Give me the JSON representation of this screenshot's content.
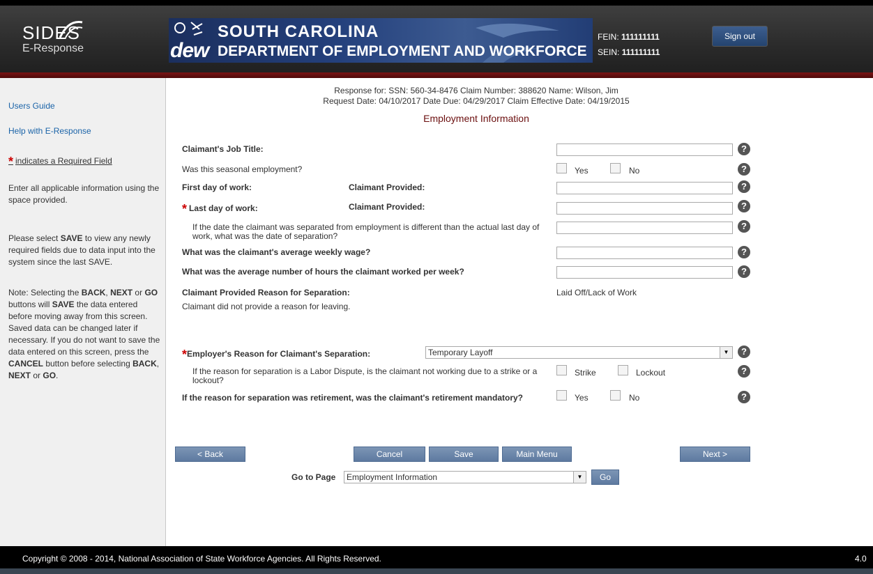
{
  "header": {
    "sides_logo_line1": "SIDES",
    "sides_logo_line2": "E-Response",
    "dew_word": "dew",
    "state_line": "SOUTH CAROLINA",
    "dept_line": "DEPARTMENT OF EMPLOYMENT AND WORKFORCE",
    "fein_label": "FEIN: ",
    "fein_value": "111111111",
    "sein_label": "SEIN: ",
    "sein_value": "111111111",
    "sign_out": "Sign out"
  },
  "sidebar": {
    "users_guide": "Users Guide",
    "help": "Help with E-Response",
    "required_star": "*",
    "required_note": "indicates a Required Field",
    "instructions": "Enter all applicable information using the space provided.",
    "save_note_1": "Please select ",
    "save_note_save": "SAVE",
    "save_note_2": " to view any newly required fields due to data input into the system since the last SAVE.",
    "nav_note_1": "Note: Selecting the ",
    "nav_note_back": "BACK",
    "nav_note_comma": ", ",
    "nav_note_next": "NEXT",
    "nav_note_or": " or ",
    "nav_note_go": "GO",
    "nav_note_2": " buttons will ",
    "nav_note_save": "SAVE",
    "nav_note_3": " the data entered before moving away from this screen. Saved data can be changed later if necessary. If you do not want to save the data entered on this screen, press the ",
    "nav_note_cancel": "CANCEL",
    "nav_note_4": " button before selecting ",
    "nav_note_back2": "BACK",
    "nav_note_comma2": ", ",
    "nav_note_next2": "NEXT",
    "nav_note_or2": " or ",
    "nav_note_go2": "GO",
    "nav_note_end": "."
  },
  "response": {
    "line1": "Response for: SSN: 560-34-8476  Claim Number: 388620  Name: Wilson, Jim",
    "line2": "Request Date: 04/10/2017  Date Due: 04/29/2017  Claim Effective Date: 04/19/2015",
    "section_title": "Employment Information"
  },
  "form": {
    "job_title_label": "Claimant's Job Title:",
    "job_title_value": "",
    "seasonal_label": "Was this seasonal employment?",
    "yes": "Yes",
    "no": "No",
    "first_day_label": "First day of work:",
    "claimant_provided": "Claimant Provided:",
    "first_day_value": "",
    "last_day_star": "*",
    "last_day_label": "Last day of work:",
    "last_day_value": "",
    "separation_date_label": "If the date the claimant was separated from employment is different than the actual last day of work, what was the date of separation?",
    "separation_date_value": "",
    "weekly_wage_label": "What was the claimant's average weekly wage?",
    "weekly_wage_value": "",
    "hours_label": "What was the average number of hours the claimant worked per week?",
    "hours_value": "",
    "claimant_reason_label": "Claimant Provided Reason for Separation:",
    "claimant_reason_value": "Laid Off/Lack of Work",
    "claimant_reason_note": "Claimant did not provide a reason for leaving.",
    "employer_reason_star": "*",
    "employer_reason_label": "Employer's Reason for Claimant's Separation:",
    "employer_reason_value": "Temporary Layoff",
    "labor_dispute_label": "If the reason for separation is a Labor Dispute, is the claimant not working due to a strike or a lockout?",
    "strike": "Strike",
    "lockout": "Lockout",
    "retirement_label": "If the reason for separation was retirement, was the claimant's retirement mandatory?",
    "help_glyph": "?"
  },
  "buttons": {
    "back": "< Back",
    "cancel": "Cancel",
    "save": "Save",
    "main_menu": "Main Menu",
    "next": "Next >",
    "goto_label": "Go to Page",
    "goto_value": "Employment Information",
    "go": "Go",
    "select_arrow": "▼"
  },
  "footer": {
    "copyright": "Copyright © 2008 - 2014, National Association of State Workforce Agencies. All Rights Reserved.",
    "version": "4.0"
  }
}
